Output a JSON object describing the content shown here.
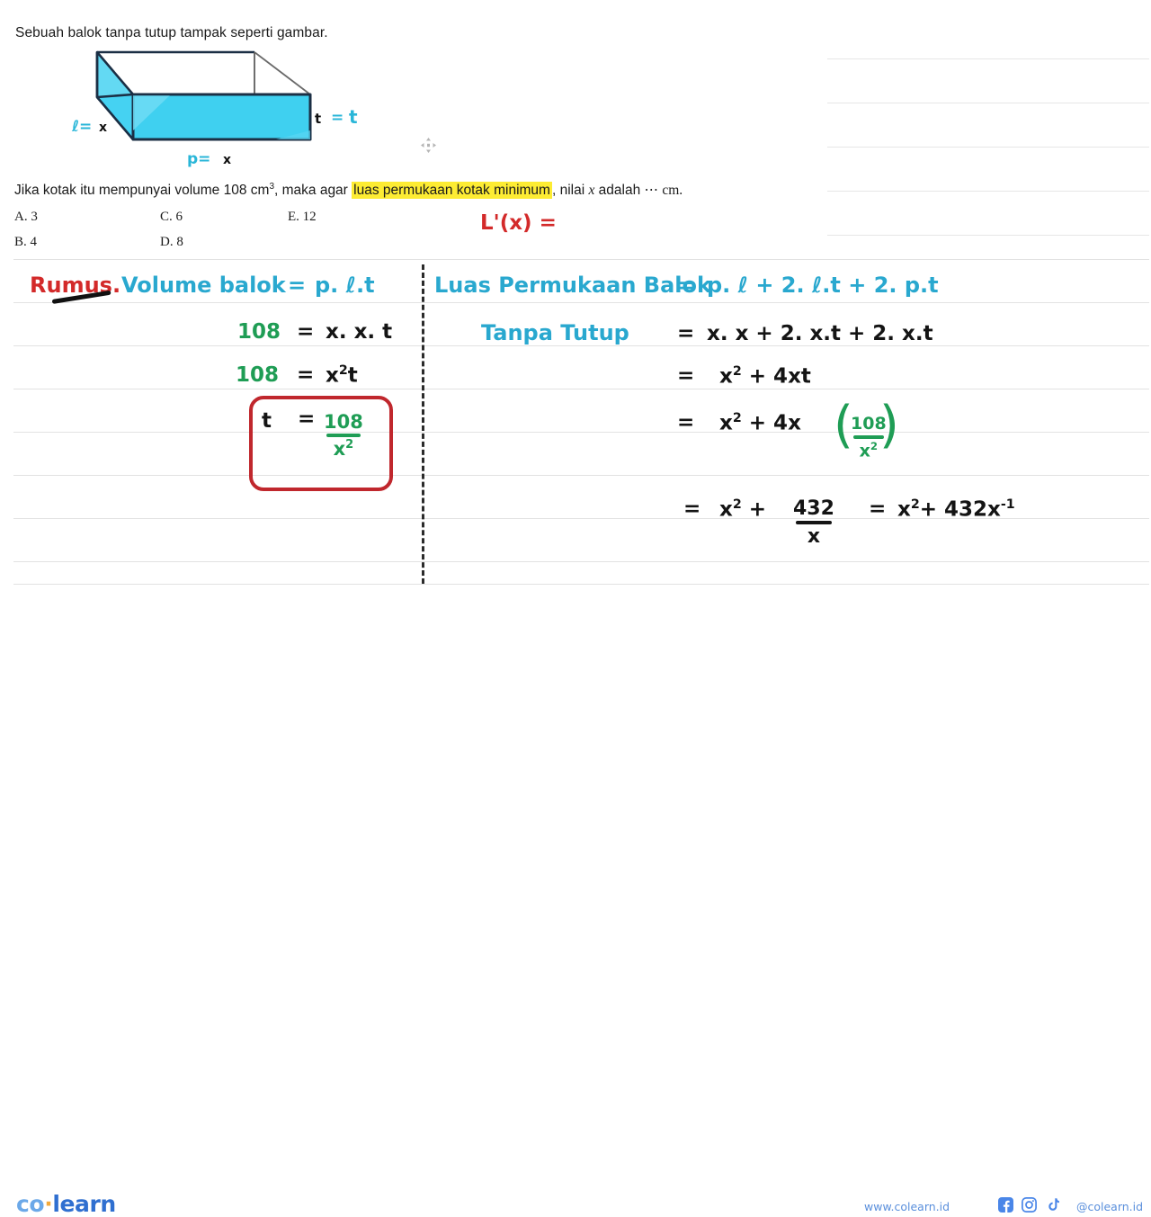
{
  "question": {
    "title": "Sebuah balok tanpa tutup tampak seperti gambar.",
    "body_pre": "Jika kotak itu mempunyai volume 108 cm",
    "body_sup": "3",
    "body_mid": ", maka agar ",
    "body_highlight": "luas permukaan kotak minimum",
    "body_post_a": ", nilai ",
    "body_var": "x",
    "body_post_b": " adalah",
    "body_dots": "⋯",
    "body_unit": "cm.",
    "options": [
      {
        "label": "A. 3"
      },
      {
        "label": "B. 4"
      },
      {
        "label": "C. 6"
      },
      {
        "label": "D. 8"
      },
      {
        "label": "E. 12"
      }
    ]
  },
  "figure": {
    "name": "open-top-rectangular-box",
    "label_length": "ℓ=",
    "label_length_value": "x",
    "label_width": "p=",
    "label_width_value": "x",
    "label_height": "t",
    "label_height_eq": "=",
    "label_height_value": "t",
    "fill_color": "#3fd0f0",
    "fill_color_dark": "#2bc4e8",
    "edge_color": "#1b2f45"
  },
  "annotation": {
    "derivative_note": "L'(x) ="
  },
  "work": {
    "left": {
      "heading_red": "Rumus.",
      "heading_blue": "Volume balok",
      "eq1_sign": "=",
      "eq1_rhs": "p. ℓ.t",
      "row2_lhs": "108",
      "row2_sign": "=",
      "row2_rhs": "x. x. t",
      "row3_lhs": "108",
      "row3_sign": "=",
      "row3_rhs_base": "x",
      "row3_rhs_sup": "2",
      "row3_rhs_tail": "t",
      "row4_lhs": "t",
      "row4_sign": "=",
      "row4_num": "108",
      "row4_den_base": "x",
      "row4_den_sup": "2",
      "box_color": "#c0272d"
    },
    "right": {
      "title_line1": "Luas Permukaan Balok",
      "title_eq1": "=",
      "title_rhs1": "p. ℓ + 2. ℓ.t + 2. p.t",
      "title_line2": "Tanpa Tutup",
      "title_eq2": "=",
      "title_rhs2": "x. x + 2. x.t + 2. x.t",
      "row3_sign": "=",
      "row3_a_base": "x",
      "row3_a_sup": "2",
      "row3_tail": "+ 4xt",
      "row4_sign": "=",
      "row4_a_base": "x",
      "row4_a_sup": "2",
      "row4_mid": "+ 4x",
      "row4_num": "108",
      "row4_den_base": "x",
      "row4_den_sup": "2",
      "row5_sign": "=",
      "row5_a_base": "x",
      "row5_a_sup": "2",
      "row5_plus": "+",
      "row5_num": "432",
      "row5_den": "x",
      "row5_sign2": "=",
      "row5_b_base": "x",
      "row5_b_sup": "2",
      "row5_b_tail": "+ 432x",
      "row5_b_sup2": "-1"
    }
  },
  "footer": {
    "logo_co": "co",
    "logo_dot": "·",
    "logo_learn": "learn",
    "website": "www.colearn.id",
    "handle": "@colearn.id",
    "social": [
      {
        "name": "facebook-icon"
      },
      {
        "name": "instagram-icon"
      },
      {
        "name": "tiktok-icon"
      }
    ]
  },
  "colors": {
    "highlight": "#fdec33",
    "red_pen": "#d32a2a",
    "blue_pen": "#29a8cf",
    "green_pen": "#1f9d55",
    "rule_line": "#e2e2e2",
    "brand_blue": "#2f6fd0"
  }
}
